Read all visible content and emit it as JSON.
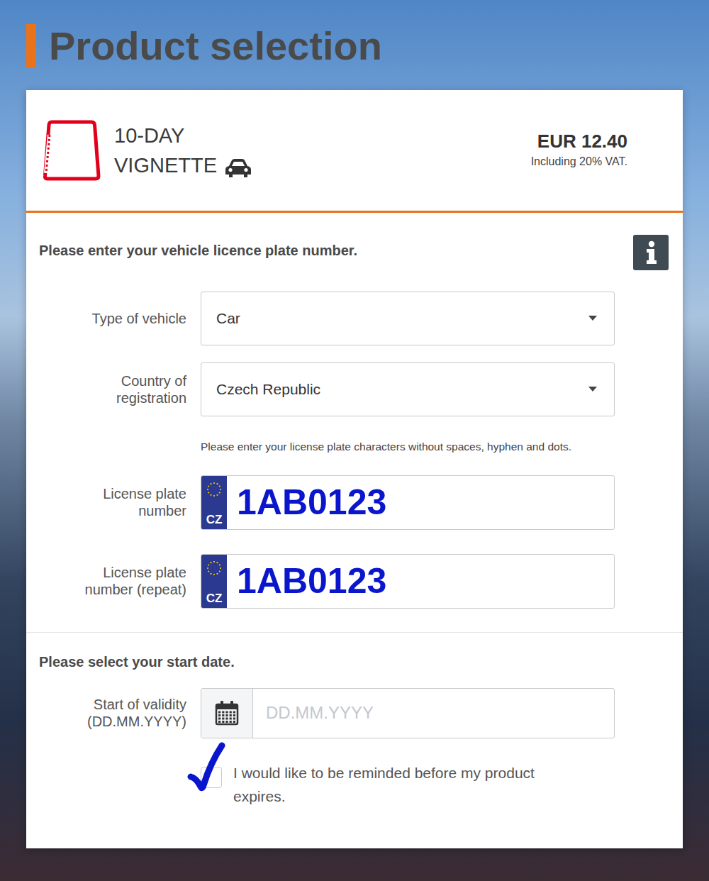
{
  "page": {
    "title": "Product selection"
  },
  "product": {
    "name": [
      "10-DAY",
      "VIGNETTE"
    ],
    "price": "EUR 12.40",
    "vat": "Including 20% VAT."
  },
  "vehicle": {
    "heading": "Please enter your vehicle licence plate number.",
    "fields": [
      {
        "kind": "select",
        "label": "Type of vehicle",
        "value": "Car"
      },
      {
        "kind": "select",
        "label": "Country of registration",
        "value": "Czech Republic"
      },
      {
        "kind": "hint",
        "text": "Please enter your license plate characters without spaces, hyphen and dots."
      },
      {
        "kind": "plate",
        "label": "License plate number",
        "country": "CZ",
        "value": "1AB0123"
      },
      {
        "kind": "plate",
        "label": "License plate number (repeat)",
        "country": "CZ",
        "value": "1AB0123"
      }
    ]
  },
  "date": {
    "heading": "Please select your start date.",
    "label": "Start of validity (DD.MM.YYYY)",
    "placeholder": "DD.MM.YYYY"
  },
  "reminder": {
    "label": "I would like to be reminded before my product expires.",
    "checked": true
  }
}
